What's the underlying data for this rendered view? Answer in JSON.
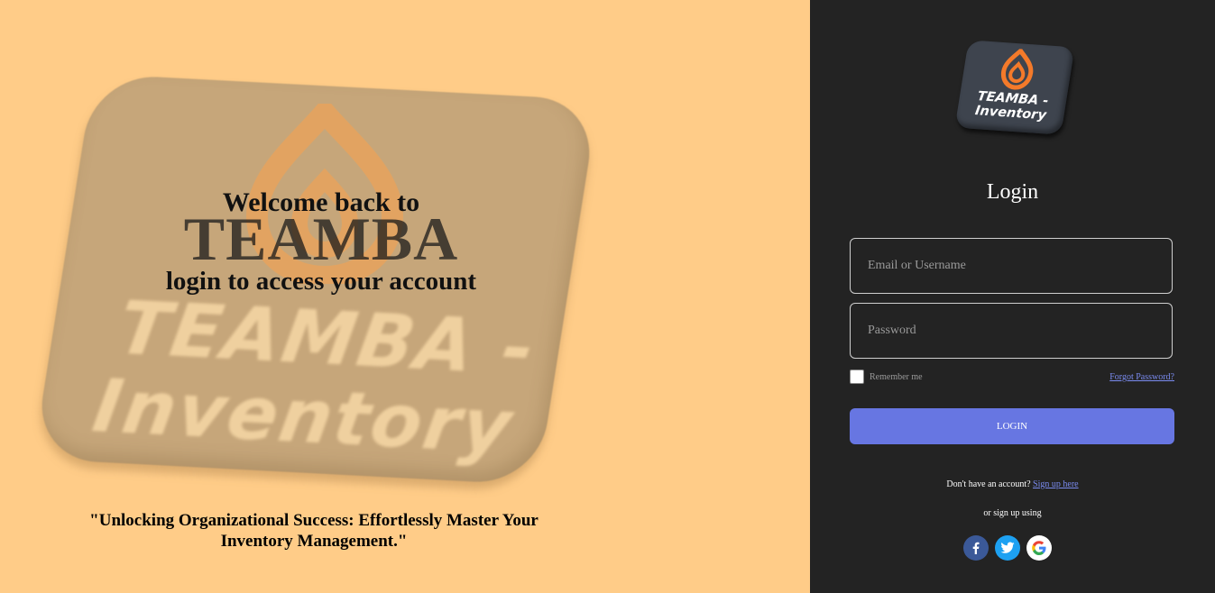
{
  "left": {
    "hero_tile_text_line1": "TEAMBA -",
    "hero_tile_text_line2": "Inventory",
    "welcome_line1": "Welcome back to",
    "welcome_brand": "TEAMBA",
    "welcome_line3": "login to access your account",
    "tagline": "\"Unlocking Organizational Success: Effortlessly Master Your Inventory Management.\""
  },
  "right": {
    "logo_text_line1": "TEAMBA -",
    "logo_text_line2": "Inventory",
    "title": "Login",
    "email_placeholder": "Email or Username",
    "password_placeholder": "Password",
    "remember_label": "Remember me",
    "remember_checked": false,
    "forgot_label": "Forgot Password?",
    "login_button": "LOGIN",
    "signup_prompt": "Don't have an account?",
    "signup_link": "Sign up here",
    "or_text": "or sign up using",
    "social": [
      {
        "name": "facebook-icon",
        "color": "#3B5998"
      },
      {
        "name": "twitter-icon",
        "color": "#1DA1F2"
      },
      {
        "name": "google-icon",
        "color": "#FFFFFF"
      }
    ]
  },
  "colors": {
    "left_bg": "#FFCC88",
    "right_bg": "#232323",
    "accent": "#6776E2",
    "link": "#7A8BF0",
    "logo_orange": "#F47A2A"
  }
}
